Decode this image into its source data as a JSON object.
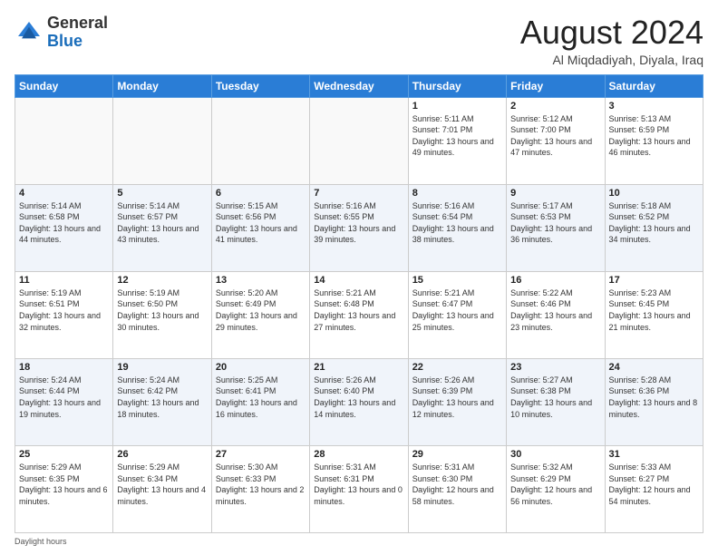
{
  "logo": {
    "line1": "General",
    "line2": "Blue"
  },
  "header": {
    "title": "August 2024",
    "subtitle": "Al Miqdadiyah, Diyala, Iraq"
  },
  "weekdays": [
    "Sunday",
    "Monday",
    "Tuesday",
    "Wednesday",
    "Thursday",
    "Friday",
    "Saturday"
  ],
  "weeks": [
    [
      {
        "day": "",
        "info": ""
      },
      {
        "day": "",
        "info": ""
      },
      {
        "day": "",
        "info": ""
      },
      {
        "day": "",
        "info": ""
      },
      {
        "day": "1",
        "info": "Sunrise: 5:11 AM\nSunset: 7:01 PM\nDaylight: 13 hours and 49 minutes."
      },
      {
        "day": "2",
        "info": "Sunrise: 5:12 AM\nSunset: 7:00 PM\nDaylight: 13 hours and 47 minutes."
      },
      {
        "day": "3",
        "info": "Sunrise: 5:13 AM\nSunset: 6:59 PM\nDaylight: 13 hours and 46 minutes."
      }
    ],
    [
      {
        "day": "4",
        "info": "Sunrise: 5:14 AM\nSunset: 6:58 PM\nDaylight: 13 hours and 44 minutes."
      },
      {
        "day": "5",
        "info": "Sunrise: 5:14 AM\nSunset: 6:57 PM\nDaylight: 13 hours and 43 minutes."
      },
      {
        "day": "6",
        "info": "Sunrise: 5:15 AM\nSunset: 6:56 PM\nDaylight: 13 hours and 41 minutes."
      },
      {
        "day": "7",
        "info": "Sunrise: 5:16 AM\nSunset: 6:55 PM\nDaylight: 13 hours and 39 minutes."
      },
      {
        "day": "8",
        "info": "Sunrise: 5:16 AM\nSunset: 6:54 PM\nDaylight: 13 hours and 38 minutes."
      },
      {
        "day": "9",
        "info": "Sunrise: 5:17 AM\nSunset: 6:53 PM\nDaylight: 13 hours and 36 minutes."
      },
      {
        "day": "10",
        "info": "Sunrise: 5:18 AM\nSunset: 6:52 PM\nDaylight: 13 hours and 34 minutes."
      }
    ],
    [
      {
        "day": "11",
        "info": "Sunrise: 5:19 AM\nSunset: 6:51 PM\nDaylight: 13 hours and 32 minutes."
      },
      {
        "day": "12",
        "info": "Sunrise: 5:19 AM\nSunset: 6:50 PM\nDaylight: 13 hours and 30 minutes."
      },
      {
        "day": "13",
        "info": "Sunrise: 5:20 AM\nSunset: 6:49 PM\nDaylight: 13 hours and 29 minutes."
      },
      {
        "day": "14",
        "info": "Sunrise: 5:21 AM\nSunset: 6:48 PM\nDaylight: 13 hours and 27 minutes."
      },
      {
        "day": "15",
        "info": "Sunrise: 5:21 AM\nSunset: 6:47 PM\nDaylight: 13 hours and 25 minutes."
      },
      {
        "day": "16",
        "info": "Sunrise: 5:22 AM\nSunset: 6:46 PM\nDaylight: 13 hours and 23 minutes."
      },
      {
        "day": "17",
        "info": "Sunrise: 5:23 AM\nSunset: 6:45 PM\nDaylight: 13 hours and 21 minutes."
      }
    ],
    [
      {
        "day": "18",
        "info": "Sunrise: 5:24 AM\nSunset: 6:44 PM\nDaylight: 13 hours and 19 minutes."
      },
      {
        "day": "19",
        "info": "Sunrise: 5:24 AM\nSunset: 6:42 PM\nDaylight: 13 hours and 18 minutes."
      },
      {
        "day": "20",
        "info": "Sunrise: 5:25 AM\nSunset: 6:41 PM\nDaylight: 13 hours and 16 minutes."
      },
      {
        "day": "21",
        "info": "Sunrise: 5:26 AM\nSunset: 6:40 PM\nDaylight: 13 hours and 14 minutes."
      },
      {
        "day": "22",
        "info": "Sunrise: 5:26 AM\nSunset: 6:39 PM\nDaylight: 13 hours and 12 minutes."
      },
      {
        "day": "23",
        "info": "Sunrise: 5:27 AM\nSunset: 6:38 PM\nDaylight: 13 hours and 10 minutes."
      },
      {
        "day": "24",
        "info": "Sunrise: 5:28 AM\nSunset: 6:36 PM\nDaylight: 13 hours and 8 minutes."
      }
    ],
    [
      {
        "day": "25",
        "info": "Sunrise: 5:29 AM\nSunset: 6:35 PM\nDaylight: 13 hours and 6 minutes."
      },
      {
        "day": "26",
        "info": "Sunrise: 5:29 AM\nSunset: 6:34 PM\nDaylight: 13 hours and 4 minutes."
      },
      {
        "day": "27",
        "info": "Sunrise: 5:30 AM\nSunset: 6:33 PM\nDaylight: 13 hours and 2 minutes."
      },
      {
        "day": "28",
        "info": "Sunrise: 5:31 AM\nSunset: 6:31 PM\nDaylight: 13 hours and 0 minutes."
      },
      {
        "day": "29",
        "info": "Sunrise: 5:31 AM\nSunset: 6:30 PM\nDaylight: 12 hours and 58 minutes."
      },
      {
        "day": "30",
        "info": "Sunrise: 5:32 AM\nSunset: 6:29 PM\nDaylight: 12 hours and 56 minutes."
      },
      {
        "day": "31",
        "info": "Sunrise: 5:33 AM\nSunset: 6:27 PM\nDaylight: 12 hours and 54 minutes."
      }
    ]
  ],
  "footer": {
    "daylight_label": "Daylight hours"
  }
}
